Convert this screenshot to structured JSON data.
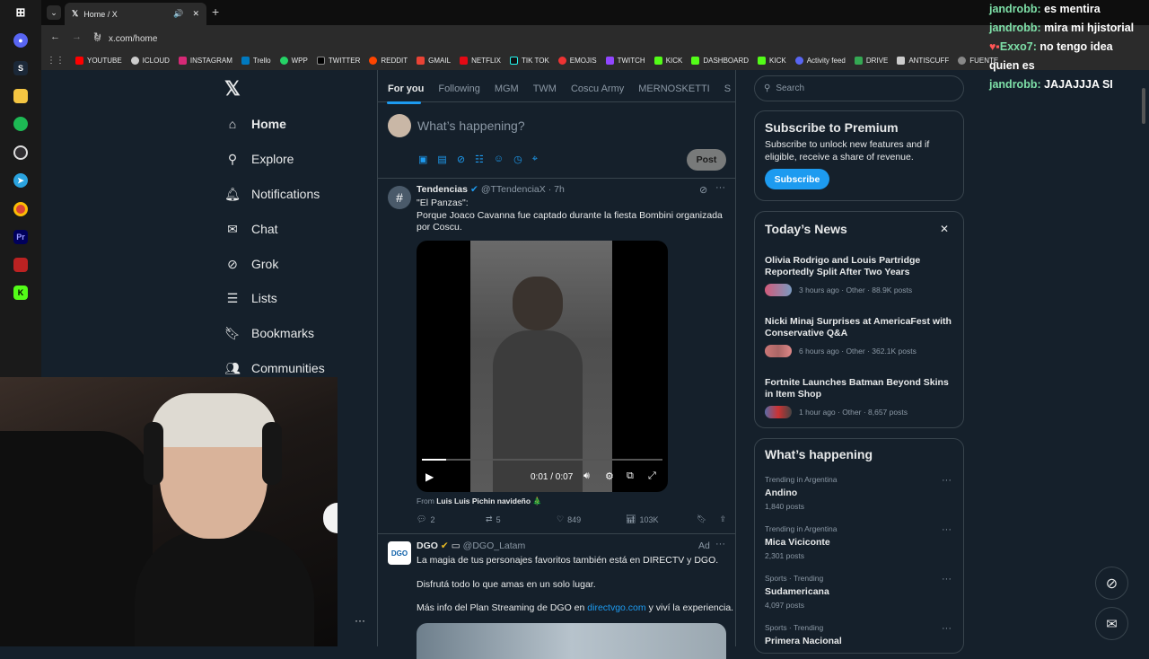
{
  "taskbar": {
    "icons": [
      "windows-icon",
      "discord-icon",
      "steam-icon",
      "files-icon",
      "spotify-icon",
      "obs-icon",
      "telegram-icon",
      "chrome-icon",
      "premiere-icon",
      "voicemeeter-icon",
      "kick-icon"
    ]
  },
  "browser": {
    "tab_title": "Home / X",
    "url": "x.com/home",
    "bookmarks": [
      "YOUTUBE",
      "ICLOUD",
      "INSTAGRAM",
      "Trello",
      "WPP",
      "TWITTER",
      "REDDIT",
      "GMAIL",
      "NETFLIX",
      "TIK TOK",
      "EMOJIS",
      "TWITCH",
      "KICK",
      "DASHBOARD",
      "KICK",
      "Activity feed",
      "DRIVE",
      "ANTISCUFF",
      "FUENTE"
    ]
  },
  "nav": {
    "items": [
      "Home",
      "Explore",
      "Notifications",
      "Chat",
      "Grok",
      "Lists",
      "Bookmarks",
      "Communities"
    ]
  },
  "feed": {
    "tabs": [
      "For you",
      "Following",
      "MGM",
      "TWM",
      "Coscu Army",
      "MERNOSKETTI",
      "S"
    ],
    "compose_placeholder": "What’s happening?",
    "post_button": "Post",
    "tweet1": {
      "name": "Tendencias",
      "handle": "@TTendenciaX",
      "time": "· 7h",
      "text1": "\"El Panzas\":",
      "text2": "Porque Joaco Cavanna fue captado durante la fiesta Bombini organizada por Coscu.",
      "video_time": "0:01 / 0:07",
      "from_label": "From",
      "from_name": "Luis Luis Pichin navideño 🎄",
      "replies": "2",
      "reposts": "5",
      "likes": "849",
      "views": "103K"
    },
    "tweet2": {
      "name": "DGO",
      "handle": "@DGO_Latam",
      "ad": "Ad",
      "text1": "La magia de tus personajes favoritos también está en DIRECTV y DGO.",
      "text2": "Disfrutá todo lo que amas en un solo lugar.",
      "text3_pre": "Más info del Plan Streaming de DGO en",
      "text3_link": "directvgo.com",
      "text3_post": "y viví la experiencia."
    }
  },
  "sidebar": {
    "search_placeholder": "Search",
    "premium": {
      "title": "Subscribe to Premium",
      "body": "Subscribe to unlock new features and if eligible, receive a share of revenue.",
      "button": "Subscribe"
    },
    "news": {
      "title": "Today’s News",
      "items": [
        {
          "headline": "Olivia Rodrigo and Louis Partridge Reportedly Split After Two Years",
          "meta": "3 hours ago · Other · 88.9K posts"
        },
        {
          "headline": "Nicki Minaj Surprises at AmericaFest with Conservative Q&A",
          "meta": "6 hours ago · Other · 362.1K posts"
        },
        {
          "headline": "Fortnite Launches Batman Beyond Skins in Item Shop",
          "meta": "1 hour ago · Other · 8,657 posts"
        }
      ]
    },
    "happening": {
      "title": "What’s happening",
      "items": [
        {
          "context": "Trending in Argentina",
          "name": "Andino",
          "posts": "1,840 posts"
        },
        {
          "context": "Trending in Argentina",
          "name": "Mica Viciconte",
          "posts": "2,301 posts"
        },
        {
          "context": "Sports · Trending",
          "name": "Sudamericana",
          "posts": "4,097 posts"
        },
        {
          "context": "Sports · Trending",
          "name": "Primera Nacional",
          "posts": ""
        }
      ]
    }
  },
  "chat": {
    "lines": [
      {
        "user": "jandrobb:",
        "msg": "es mentira"
      },
      {
        "user": "jandrobb:",
        "msg": "mira mi hjistorial"
      },
      {
        "user": "Exxo7:",
        "msg": "no tengo idea quien es"
      },
      {
        "user": "jandrobb:",
        "msg": "JAJAJJJA SI"
      }
    ]
  },
  "colors": {
    "bg": "#15202b",
    "accent": "#1d9bf0",
    "border": "#38444d",
    "chat_user": "#7ee0a8"
  }
}
